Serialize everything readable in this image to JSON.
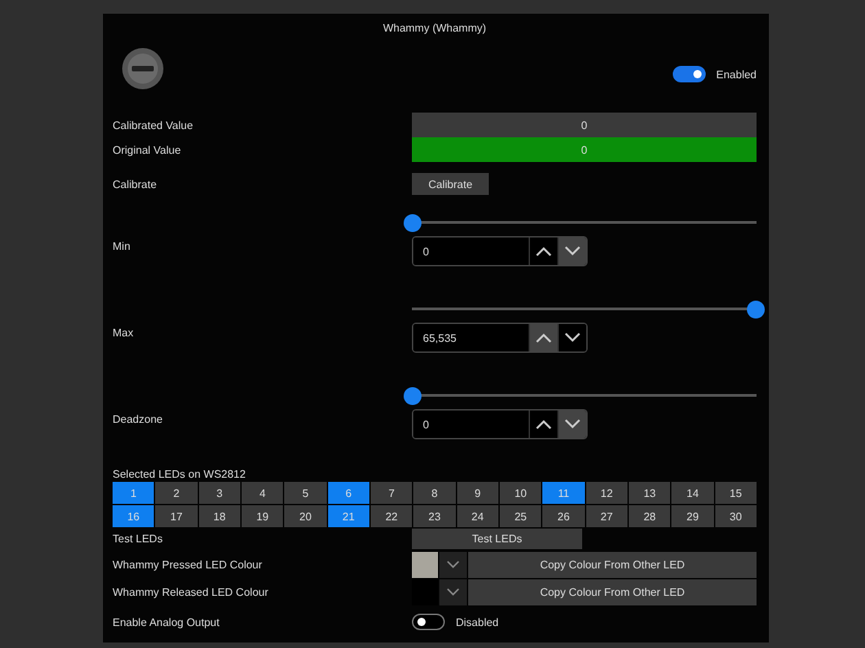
{
  "title": "Whammy (Whammy)",
  "enabled_toggle": {
    "on": true,
    "label": "Enabled"
  },
  "values": [
    {
      "label": "Calibrated Value",
      "value": "0",
      "kind": "plain"
    },
    {
      "label": "Original Value",
      "value": "0",
      "kind": "green"
    }
  ],
  "calibrate": {
    "label": "Calibrate",
    "button": "Calibrate"
  },
  "ranges": [
    {
      "label": "Min",
      "level": 0,
      "value": "0",
      "up_highlighted": false,
      "down_highlighted": true
    },
    {
      "label": "Max",
      "level": 1,
      "value": "65,535",
      "up_highlighted": true,
      "down_highlighted": false
    },
    {
      "label": "Deadzone",
      "level": 0,
      "value": "0",
      "up_highlighted": false,
      "down_highlighted": true
    }
  ],
  "leds": {
    "label": "Selected LEDs on WS2812",
    "items": [
      {
        "label": "1",
        "selected": true
      },
      {
        "label": "2",
        "selected": false
      },
      {
        "label": "3",
        "selected": false
      },
      {
        "label": "4",
        "selected": false
      },
      {
        "label": "5",
        "selected": false
      },
      {
        "label": "6",
        "selected": true
      },
      {
        "label": "7",
        "selected": false
      },
      {
        "label": "8",
        "selected": false
      },
      {
        "label": "9",
        "selected": false
      },
      {
        "label": "10",
        "selected": false
      },
      {
        "label": "11",
        "selected": true
      },
      {
        "label": "12",
        "selected": false
      },
      {
        "label": "13",
        "selected": false
      },
      {
        "label": "14",
        "selected": false
      },
      {
        "label": "15",
        "selected": false
      },
      {
        "label": "16",
        "selected": true
      },
      {
        "label": "17",
        "selected": false
      },
      {
        "label": "18",
        "selected": false
      },
      {
        "label": "19",
        "selected": false
      },
      {
        "label": "20",
        "selected": false
      },
      {
        "label": "21",
        "selected": true
      },
      {
        "label": "22",
        "selected": false
      },
      {
        "label": "23",
        "selected": false
      },
      {
        "label": "24",
        "selected": false
      },
      {
        "label": "25",
        "selected": false
      },
      {
        "label": "26",
        "selected": false
      },
      {
        "label": "27",
        "selected": false
      },
      {
        "label": "28",
        "selected": false
      },
      {
        "label": "29",
        "selected": false
      },
      {
        "label": "30",
        "selected": false
      }
    ]
  },
  "test_leds": {
    "label": "Test LEDs",
    "button": "Test LEDs"
  },
  "colours": [
    {
      "label": "Whammy Pressed LED Colour",
      "color": "#a8a59c",
      "button": "Copy Colour From Other LED"
    },
    {
      "label": "Whammy Released LED Colour",
      "color": "#000000",
      "button": "Copy Colour From Other LED"
    }
  ],
  "analog_output": {
    "label": "Enable Analog Output",
    "on": false,
    "state": "Disabled"
  }
}
